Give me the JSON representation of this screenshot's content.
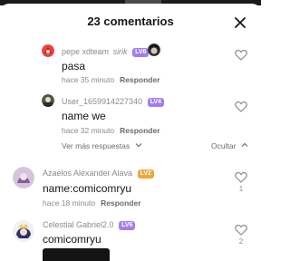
{
  "header": {
    "title": "23 comentarios"
  },
  "colors": {
    "badge_purple": "#a37ef0",
    "badge_orange": "#f3a53a",
    "muted": "#8a8a8a"
  },
  "comments": [
    {
      "author": "pepe xdteam",
      "author_extra": "sirik",
      "badge": "LV6",
      "text": "pasa",
      "time": "hace 35 minuto",
      "reply": "Responder"
    },
    {
      "author": "User_1659914227340",
      "badge": "LV4",
      "text": "name we",
      "time": "hace 32 minuto",
      "reply": "Responder"
    },
    {
      "author": "Azaelos Alexander Alava",
      "badge": "LV2",
      "text": "name:comicomryu",
      "time": "hace 18 minuto",
      "reply": "Responder",
      "likes": "1"
    },
    {
      "author": "Celestial Gabriel2.0",
      "badge": "LV6",
      "text": "comicomryu",
      "likes": "2"
    }
  ],
  "replies_controls": {
    "show_more": "Ver más respuestas",
    "hide": "Ocultar"
  },
  "icons": [
    "close-icon",
    "heart-icon",
    "chevron-down-icon",
    "chevron-up-icon"
  ]
}
